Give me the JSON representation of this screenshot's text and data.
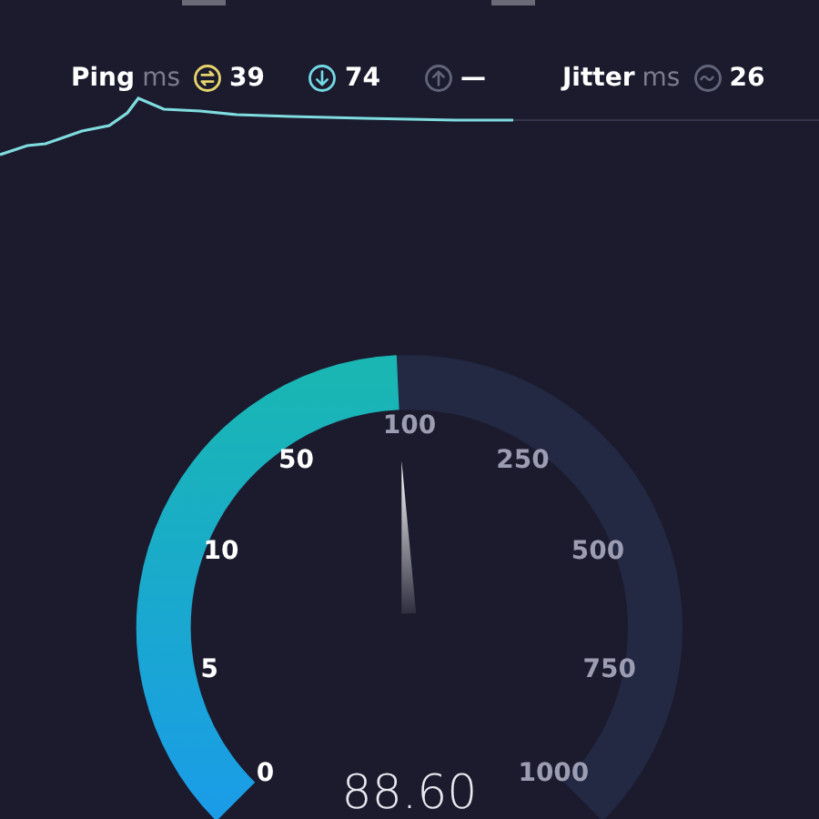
{
  "stats": [
    {
      "kind": "ping",
      "label": "Ping",
      "unit": "ms",
      "value": "39"
    },
    {
      "kind": "download",
      "value": "74"
    },
    {
      "kind": "upload",
      "value": "—"
    },
    {
      "kind": "jitter",
      "label": "Jitter",
      "unit": "ms",
      "value": "26"
    }
  ],
  "gauge": {
    "ticks": [
      "0",
      "5",
      "10",
      "50",
      "100",
      "250",
      "500",
      "750",
      "1000"
    ],
    "reading": "88.60"
  }
}
